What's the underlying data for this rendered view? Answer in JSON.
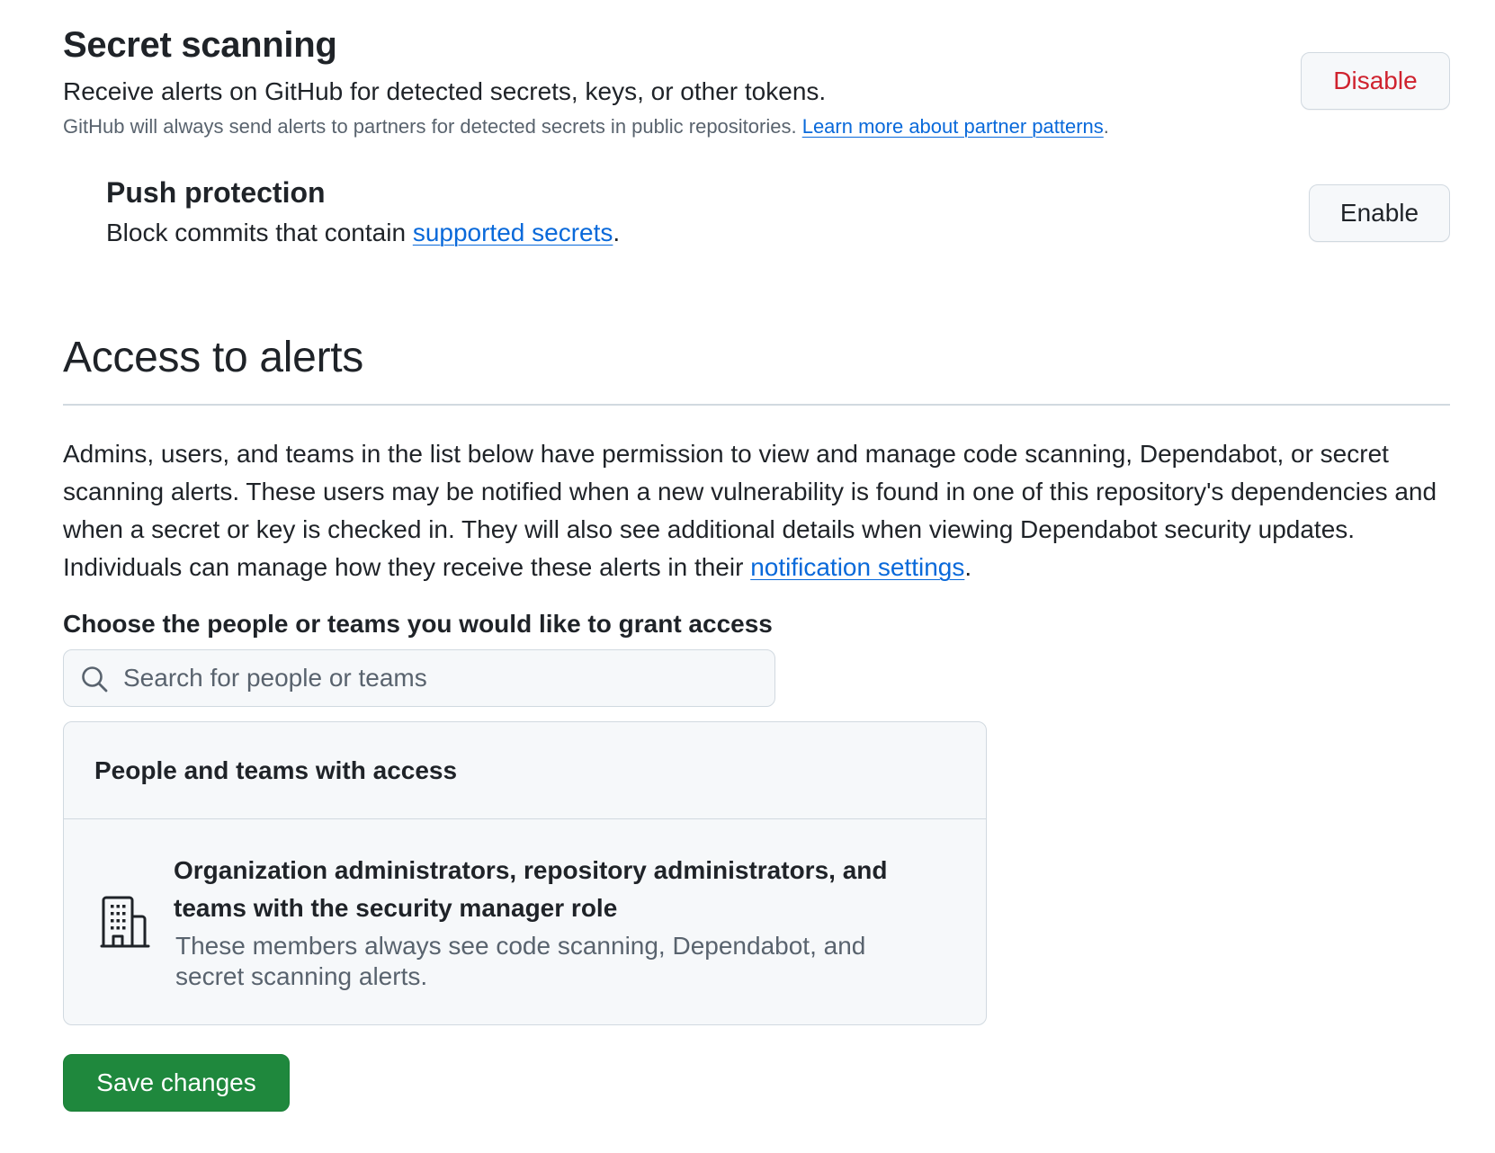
{
  "secret_scanning": {
    "title": "Secret scanning",
    "description": "Receive alerts on GitHub for detected secrets, keys, or other tokens.",
    "note": "GitHub will always send alerts to partners for detected secrets in public repositories. ",
    "note_link": "Learn more about partner patterns",
    "note_end": ".",
    "disable_label": "Disable"
  },
  "push_protection": {
    "title": "Push protection",
    "description": "Block commits that contain ",
    "link": "supported secrets",
    "end": ".",
    "enable_label": "Enable"
  },
  "access_to_alerts": {
    "title": "Access to alerts",
    "paragraph": "Admins, users, and teams in the list below have permission to view and manage code scanning, Dependabot, or secret scanning alerts. These users may be notified when a new vulnerability is found in one of this repository's dependencies and when a secret or key is checked in. They will also see additional details when viewing Dependabot security updates. Individuals can manage how they receive these alerts in their ",
    "paragraph_link": "notification settings",
    "paragraph_end": ".",
    "choose_label": "Choose the people or teams you would like to grant access",
    "search_placeholder": "Search for people or teams",
    "search_value": "",
    "panel": {
      "title": "People and teams with access",
      "item_title": "Organization administrators, repository administrators, and teams with the security manager role",
      "item_description": "These members always see code scanning, Dependabot, and secret scanning alerts.",
      "item_icon": "organization-icon"
    },
    "save_label": "Save changes"
  },
  "colors": {
    "danger": "#cf222e",
    "link": "#0969da",
    "primary_button": "#1f883d",
    "muted_text": "#59636e",
    "border": "#d1d9e0"
  }
}
